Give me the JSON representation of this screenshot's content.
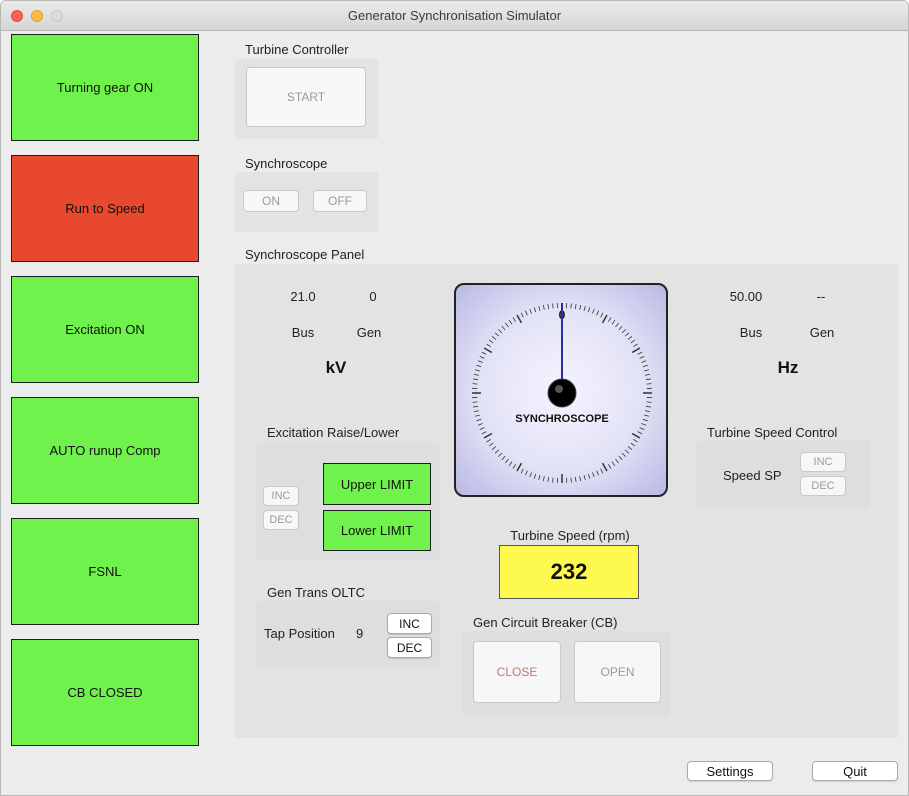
{
  "window": {
    "title": "Generator Synchronisation Simulator"
  },
  "status_boxes": [
    {
      "label": "Turning gear ON",
      "color": "#6ff24b"
    },
    {
      "label": "Run to Speed",
      "color": "#e8482d"
    },
    {
      "label": "Excitation ON",
      "color": "#6ff24b"
    },
    {
      "label": "AUTO runup Comp",
      "color": "#6ff24b"
    },
    {
      "label": "FSNL",
      "color": "#6ff24b"
    },
    {
      "label": "CB CLOSED",
      "color": "#6ff24b"
    }
  ],
  "turbine_controller": {
    "label": "Turbine Controller",
    "start": "START"
  },
  "synchroscope_ctrl": {
    "label": "Synchroscope",
    "on": "ON",
    "off": "OFF"
  },
  "panel": {
    "label": "Synchroscope Panel",
    "kv": {
      "bus_value": "21.0",
      "gen_value": "0",
      "bus_label": "Bus",
      "gen_label": "Gen",
      "unit": "kV"
    },
    "hz": {
      "bus_value": "50.00",
      "gen_value": "--",
      "bus_label": "Bus",
      "gen_label": "Gen",
      "unit": "Hz"
    },
    "scope": {
      "label": "SYNCHROSCOPE",
      "zero": "0",
      "needle_angle_deg": 0
    },
    "excitation": {
      "label": "Excitation Raise/Lower",
      "inc": "INC",
      "dec": "DEC",
      "upper": "Upper LIMIT",
      "lower": "Lower LIMIT"
    },
    "oltc": {
      "label": "Gen Trans OLTC",
      "tap_label": "Tap Position",
      "tap_value": "9",
      "inc": "INC",
      "dec": "DEC"
    },
    "turbine_speed": {
      "label": "Turbine Speed (rpm)",
      "value": "232"
    },
    "breaker": {
      "label": "Gen Circuit Breaker (CB)",
      "close": "CLOSE",
      "open": "OPEN"
    },
    "speed_control": {
      "label": "Turbine Speed Control",
      "sp_label": "Speed SP",
      "inc": "INC",
      "dec": "DEC"
    }
  },
  "footer": {
    "settings": "Settings",
    "quit": "Quit"
  },
  "colors": {
    "indicator_green": "#6ff24b",
    "indicator_red": "#e8482d",
    "speed_yellow": "#fdf94f"
  }
}
